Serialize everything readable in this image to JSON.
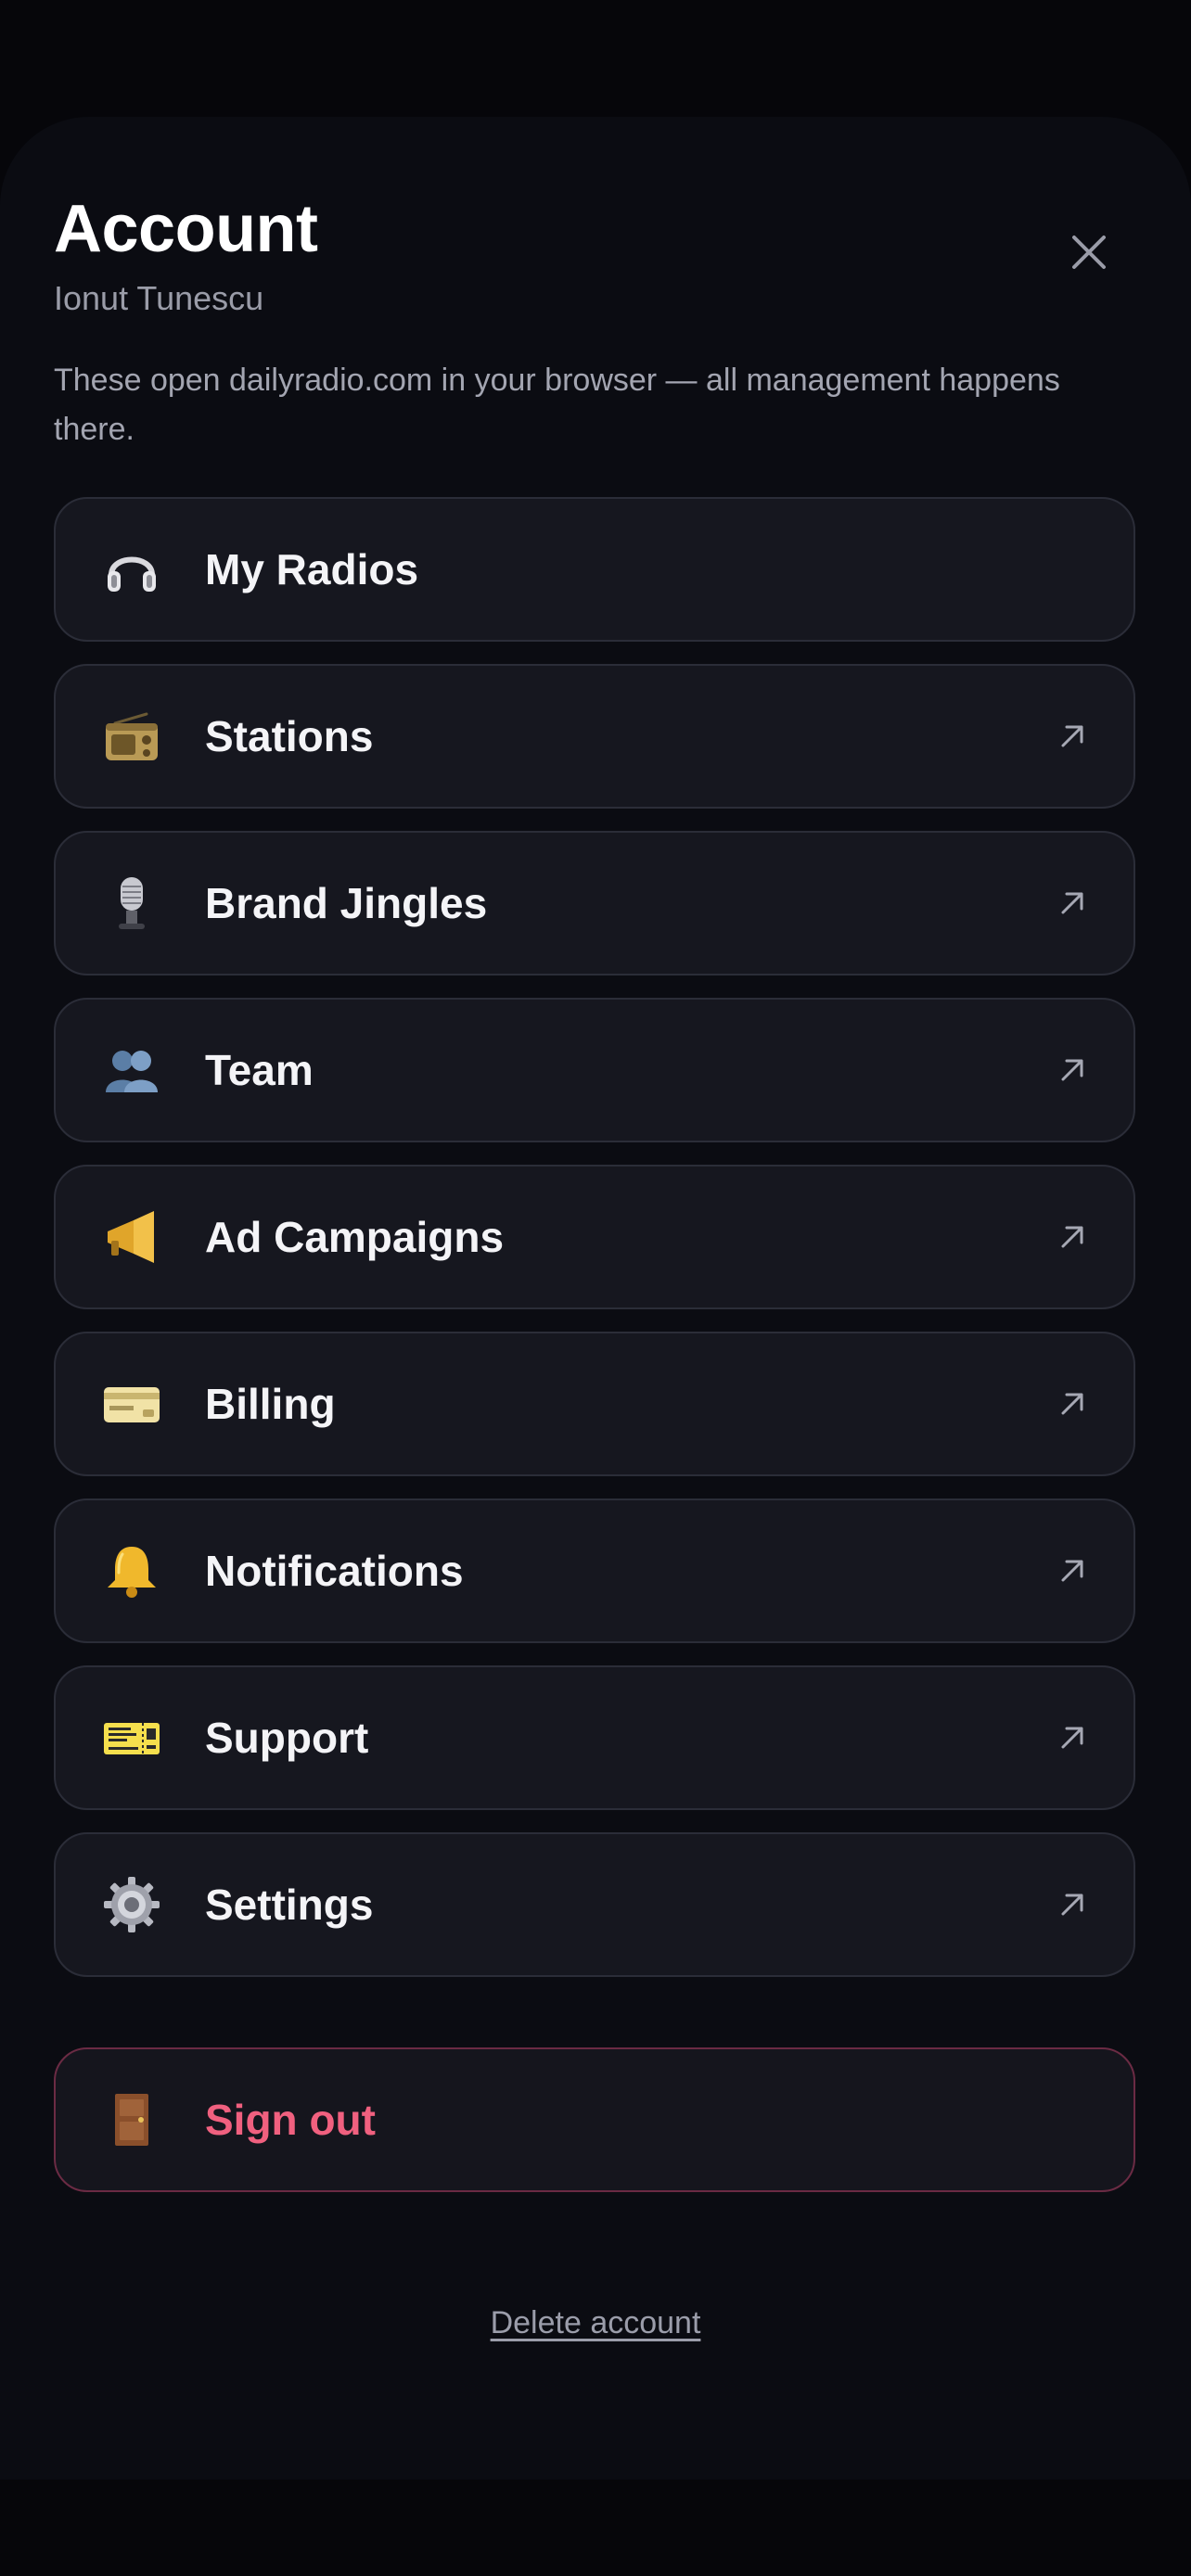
{
  "header": {
    "title": "Account",
    "username": "Ionut Tunescu",
    "description": "These open dailyradio.com in your browser — all management happens there."
  },
  "menu": {
    "items": [
      {
        "label": "My Radios",
        "icon": "headphone-icon",
        "external": false
      },
      {
        "label": "Stations",
        "icon": "radio-icon",
        "external": true
      },
      {
        "label": "Brand Jingles",
        "icon": "microphone-icon",
        "external": true
      },
      {
        "label": "Team",
        "icon": "people-icon",
        "external": true
      },
      {
        "label": "Ad Campaigns",
        "icon": "megaphone-icon",
        "external": true
      },
      {
        "label": "Billing",
        "icon": "credit-card-icon",
        "external": true
      },
      {
        "label": "Notifications",
        "icon": "bell-icon",
        "external": true
      },
      {
        "label": "Support",
        "icon": "ticket-icon",
        "external": true
      },
      {
        "label": "Settings",
        "icon": "gear-icon",
        "external": true
      }
    ]
  },
  "signout": {
    "label": "Sign out",
    "icon": "door-icon"
  },
  "footer": {
    "delete_label": "Delete account"
  },
  "colors": {
    "background": "#0b0c12",
    "card": "#16171f",
    "card_border": "#2b2d38",
    "danger": "#f0607f",
    "danger_border": "#6b2b44"
  }
}
